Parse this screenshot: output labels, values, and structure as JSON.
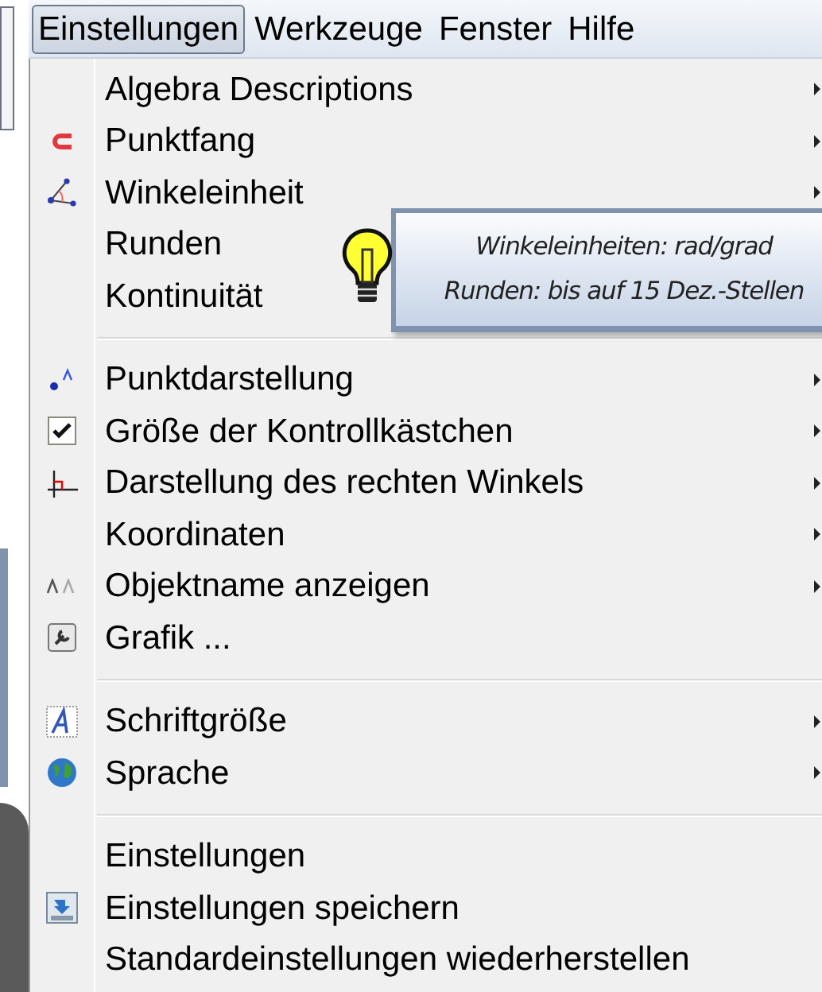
{
  "menubar": [
    {
      "label": "Einstellungen",
      "selected": true
    },
    {
      "label": "Werkzeuge",
      "selected": false
    },
    {
      "label": "Fenster",
      "selected": false
    },
    {
      "label": "Hilfe",
      "selected": false
    }
  ],
  "menu": [
    {
      "kind": "item",
      "label": "Algebra Descriptions",
      "submenu": true
    },
    {
      "kind": "item",
      "label": "Punktfang",
      "submenu": true
    },
    {
      "kind": "item",
      "label": "Winkeleinheit",
      "submenu": true
    },
    {
      "kind": "item",
      "label": "Runden",
      "submenu": false
    },
    {
      "kind": "item",
      "label": "Kontinuität",
      "submenu": false
    },
    {
      "kind": "separator"
    },
    {
      "kind": "item",
      "label": "Punktdarstellung",
      "submenu": true
    },
    {
      "kind": "item",
      "label": "Größe der Kontrollkästchen",
      "submenu": true
    },
    {
      "kind": "item",
      "label": "Darstellung des rechten Winkels",
      "submenu": true
    },
    {
      "kind": "item",
      "label": "Koordinaten",
      "submenu": true
    },
    {
      "kind": "item",
      "label": "Objektname anzeigen",
      "submenu": true
    },
    {
      "kind": "item",
      "label": "Grafik ...",
      "submenu": false
    },
    {
      "kind": "separator"
    },
    {
      "kind": "item",
      "label": "Schriftgröße",
      "submenu": true
    },
    {
      "kind": "item",
      "label": "Sprache",
      "submenu": true
    },
    {
      "kind": "separator"
    },
    {
      "kind": "item",
      "label": "Einstellungen",
      "submenu": false
    },
    {
      "kind": "item",
      "label": "Einstellungen speichern",
      "submenu": false
    },
    {
      "kind": "item",
      "label": "Standardeinstellungen wiederherstellen",
      "submenu": false
    }
  ],
  "tooltip": {
    "lines": [
      "Winkeleinheiten: rad/grad",
      "Runden: bis auf 15 Dez.-Stellen"
    ]
  }
}
